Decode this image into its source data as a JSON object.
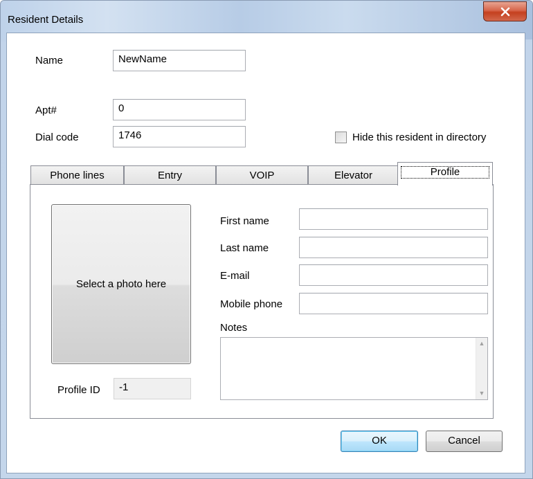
{
  "window": {
    "title": "Resident Details"
  },
  "fields": {
    "name_label": "Name",
    "name_value": "NewName",
    "apt_label": "Apt#",
    "apt_value": "0",
    "dial_label": "Dial code",
    "dial_value": "1746",
    "hide_label": "Hide this resident in directory",
    "hide_checked": false
  },
  "tabs": [
    "Phone lines",
    "Entry",
    "VOIP",
    "Elevator",
    "Profile"
  ],
  "active_tab": "Profile",
  "profile": {
    "photo_label": "Select a photo here",
    "profile_id_label": "Profile ID",
    "profile_id_value": "-1",
    "first_name_label": "First name",
    "first_name_value": "",
    "last_name_label": "Last name",
    "last_name_value": "",
    "email_label": "E-mail",
    "email_value": "",
    "mobile_label": "Mobile phone",
    "mobile_value": "",
    "notes_label": "Notes",
    "notes_value": ""
  },
  "buttons": {
    "ok": "OK",
    "cancel": "Cancel"
  },
  "icons": {
    "close": "close-icon",
    "scroll_up": "scroll-up-arrow-icon",
    "scroll_down": "scroll-down-arrow-icon"
  },
  "colors": {
    "close_button": "#c4401f",
    "default_button_border": "#3c7fb1"
  }
}
